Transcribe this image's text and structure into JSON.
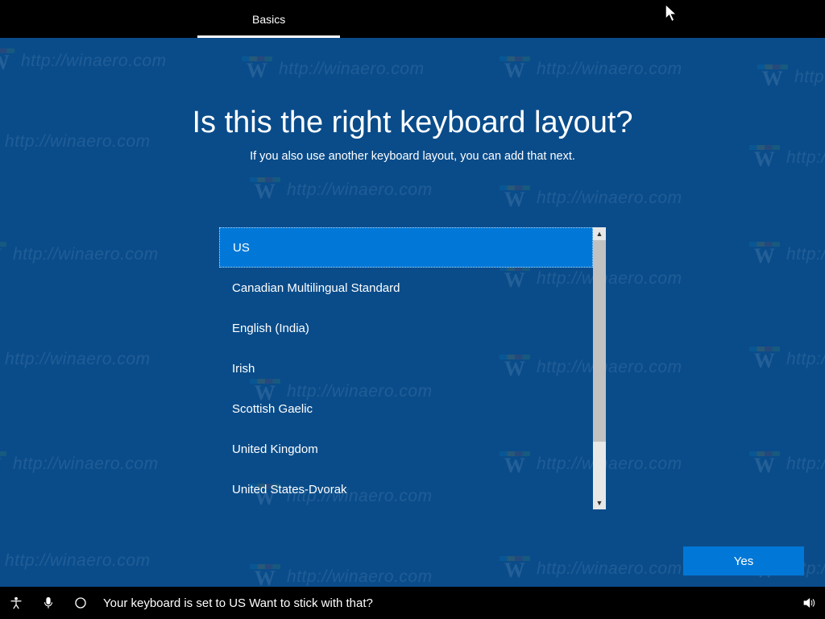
{
  "tabbar": {
    "tabs": [
      {
        "label": "Basics",
        "active": true
      }
    ]
  },
  "main": {
    "title": "Is this the right keyboard layout?",
    "subtitle": "If you also use another keyboard layout, you can add that next.",
    "keyboard_layouts": [
      "US",
      "Canadian Multilingual Standard",
      "English (India)",
      "Irish",
      "Scottish Gaelic",
      "United Kingdom",
      "United States-Dvorak"
    ],
    "selected_index": 0,
    "yes_label": "Yes"
  },
  "taskbar": {
    "cortana_text": "Your keyboard is set to US Want to stick with that?"
  },
  "watermark_text": "http://winaero.com",
  "colors": {
    "accent": "#0178d7",
    "background": "#0a4c8a",
    "black": "#000000"
  }
}
